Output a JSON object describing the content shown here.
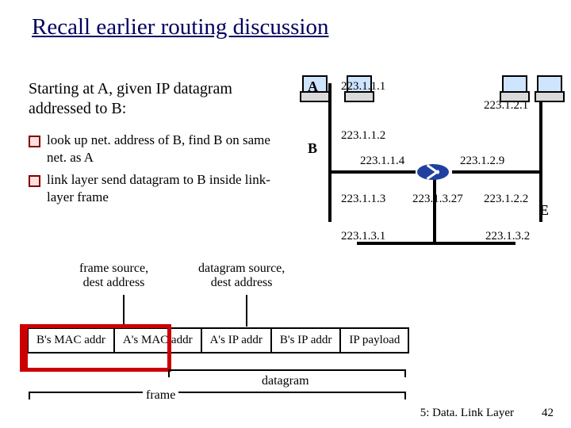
{
  "title": "Recall earlier routing discussion",
  "intro": "Starting at A, given IP datagram addressed to B:",
  "bullets": [
    "look up net. address of B, find B on same net. as A",
    "link layer send datagram to B inside link-layer frame"
  ],
  "net": {
    "labels": {
      "A": "A",
      "B": "B",
      "E": "E"
    },
    "ips": {
      "a": "223.1.1.1",
      "b": "223.1.1.2",
      "c": "223.1.1.3",
      "d": "223.1.1.4",
      "e": "223.1.2.1",
      "f": "223.1.2.2",
      "g": "223.1.2.9",
      "h": "223.1.3.27",
      "i": "223.1.3.1",
      "j": "223.1.3.2"
    }
  },
  "annot": {
    "frame_src_dest": "frame source,\ndest address",
    "dgram_src_dest": "datagram source,\ndest address"
  },
  "frame_row": {
    "c1": "B's MAC addr",
    "c2": "A's MAC addr",
    "c3": "A's IP addr",
    "c4": "B's IP addr",
    "c5": "IP payload"
  },
  "braces": {
    "datagram": "datagram",
    "frame": "frame"
  },
  "footer": {
    "chapter": "5: Data. Link Layer",
    "page": "42"
  }
}
